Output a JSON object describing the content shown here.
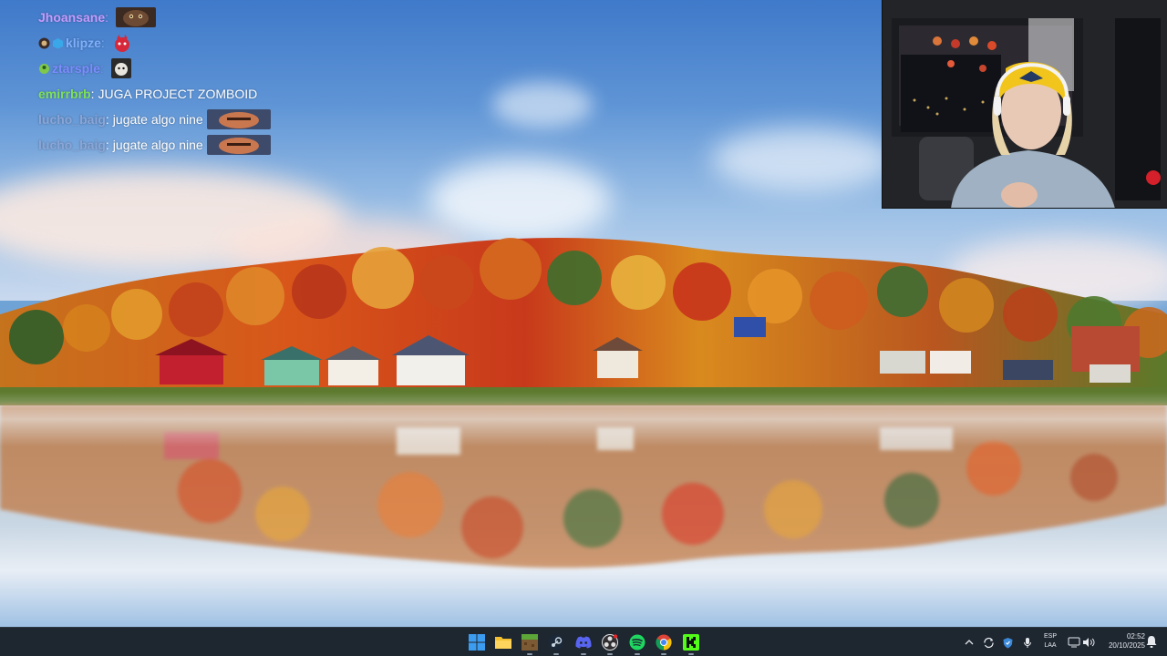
{
  "chat": {
    "messages": [
      {
        "user": "Jhoansane",
        "sep": ":",
        "text": "",
        "user_color": "#c59bff",
        "emote": "emote-cat"
      },
      {
        "user": "klipze",
        "sep": ":",
        "text": "",
        "user_color": "#7fb0ff",
        "emote": "emote-red-creature"
      },
      {
        "user": "ztarsple",
        "sep": ":",
        "text": "",
        "user_color": "#7d8cff",
        "emote": "emote-dog"
      },
      {
        "user": "emirrbrb",
        "sep": ":",
        "text": "JUGA PROJECT ZOMBOID",
        "user_color": "#7ee05a",
        "emote": ""
      },
      {
        "user": "lucho_baig",
        "sep": ":",
        "text": "jugate algo nine",
        "user_color": "#8aa6d8",
        "emote": "emote-face"
      },
      {
        "user": "lucho_baig",
        "sep": ":",
        "text": "jugate algo nine",
        "user_color": "#8aa6d8",
        "emote": "emote-face"
      }
    ]
  },
  "webcam": {
    "description": "streamer-webcam"
  },
  "taskbar": {
    "pinned": [
      {
        "name": "start-icon"
      },
      {
        "name": "file-explorer-icon"
      },
      {
        "name": "minecraft-icon"
      },
      {
        "name": "steam-icon"
      },
      {
        "name": "discord-icon"
      },
      {
        "name": "obs-icon"
      },
      {
        "name": "spotify-icon"
      },
      {
        "name": "chrome-icon"
      },
      {
        "name": "kick-icon"
      }
    ],
    "tray": {
      "language_line1": "ESP",
      "language_line2": "LAA",
      "time": "02:52",
      "date": "20/10/2025"
    }
  },
  "colors": {
    "taskbar_bg": "#1e2630",
    "spotify": "#1ed760",
    "discord": "#5865f2",
    "kick": "#53fc18",
    "windows_blue": "#3c9cf0"
  }
}
